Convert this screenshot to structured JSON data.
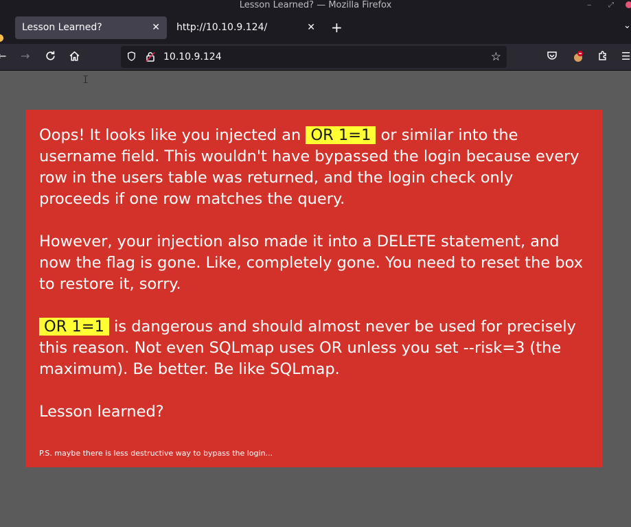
{
  "window": {
    "title": "Lesson Learned? — Mozilla Firefox"
  },
  "tabs": [
    {
      "label": "Lesson Learned?",
      "active": true
    },
    {
      "label": "http://10.10.9.124/",
      "active": false
    }
  ],
  "tab_controls": {
    "close": "✕",
    "new_tab": "+",
    "list": "⌄"
  },
  "navbar": {
    "url": "10.10.9.124",
    "icons": [
      "back-arrow-icon",
      "forward-arrow-icon",
      "reload-icon",
      "home-icon",
      "shield-icon",
      "lock-icon",
      "bookmark-star-icon",
      "pocket-icon",
      "extension-icon",
      "puzzle-icon",
      "menu-icon"
    ]
  },
  "content": {
    "para1_before": "Oops! It looks like you injected an ",
    "para1_highlight": "OR 1=1",
    "para1_after": " or similar into the username field. This wouldn't have bypassed the login because every row in the users table was returned, and the login check only proceeds if one row matches the query.",
    "para2": "However, your injection also made it into a DELETE statement, and now the flag is gone. Like, completely gone. You need to reset the box to restore it, sorry.",
    "para3_highlight": "OR 1=1",
    "para3_after": " is dangerous and should almost never be used for precisely this reason. Not even SQLmap uses OR unless you set --risk=3 (the maximum). Be better. Be like SQLmap.",
    "para4": "Lesson learned?",
    "ps": "P.S. maybe there is less destructive way to bypass the login..."
  },
  "colors": {
    "panel_bg": "#d3322b",
    "highlight": "#ffff33",
    "page_bg": "#5b5b5b",
    "chrome_bg": "#1c1b22"
  }
}
